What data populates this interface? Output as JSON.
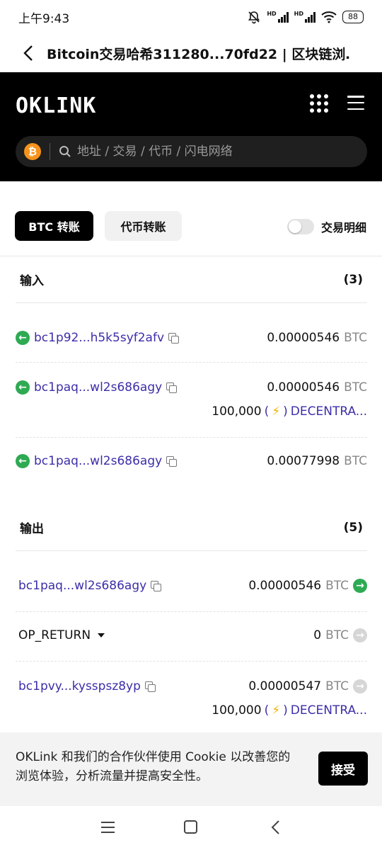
{
  "status": {
    "time": "上午9:43",
    "battery": "88",
    "hd1": "HD",
    "hd2": "HD"
  },
  "browser": {
    "title": "Bitcoin交易哈希311280...70fd22 | 区块链浏…"
  },
  "header": {
    "logo": "OKLINK",
    "search_placeholder": "地址 / 交易 / 代币 / 闪电网络",
    "coin_symbol": "₿"
  },
  "tabs": {
    "btc_transfer": "BTC 转账",
    "token_transfer": "代币转账",
    "detail_toggle": "交易明细"
  },
  "inputs": {
    "label": "输入",
    "count": "(3)",
    "rows": [
      {
        "address": "bc1p92...h5k5syf2afv",
        "amount": "0.00000546",
        "unit": "BTC"
      },
      {
        "address": "bc1paq...wl2s686agy",
        "amount": "0.00000546",
        "unit": "BTC",
        "token_amount": "100,000",
        "token_open": "(",
        "token_bolt": "⚡",
        "token_close": ")",
        "token_name": "DECENTRA..."
      },
      {
        "address": "bc1paq...wl2s686agy",
        "amount": "0.00077998",
        "unit": "BTC"
      }
    ]
  },
  "outputs": {
    "label": "输出",
    "count": "(5)",
    "rows": [
      {
        "address": "bc1paq...wl2s686agy",
        "amount": "0.00000546",
        "unit": "BTC"
      },
      {
        "address": "OP_RETURN",
        "amount": "0",
        "unit": "BTC"
      },
      {
        "address": "bc1pvy...kysspsz8yp",
        "amount": "0.00000547",
        "unit": "BTC",
        "token_amount": "100,000",
        "token_open": "(",
        "token_bolt": "⚡",
        "token_close": ")",
        "token_name": "DECENTRA..."
      }
    ]
  },
  "cookie": {
    "text": "OKLink 和我们的合作伙伴使用 Cookie 以改善您的浏览体验，分析流量并提高安全性。",
    "accept": "接受"
  },
  "colors": {
    "accent_green": "#2eaa52",
    "link_purple": "#3b2ea8",
    "bitcoin_orange": "#f7931a"
  }
}
